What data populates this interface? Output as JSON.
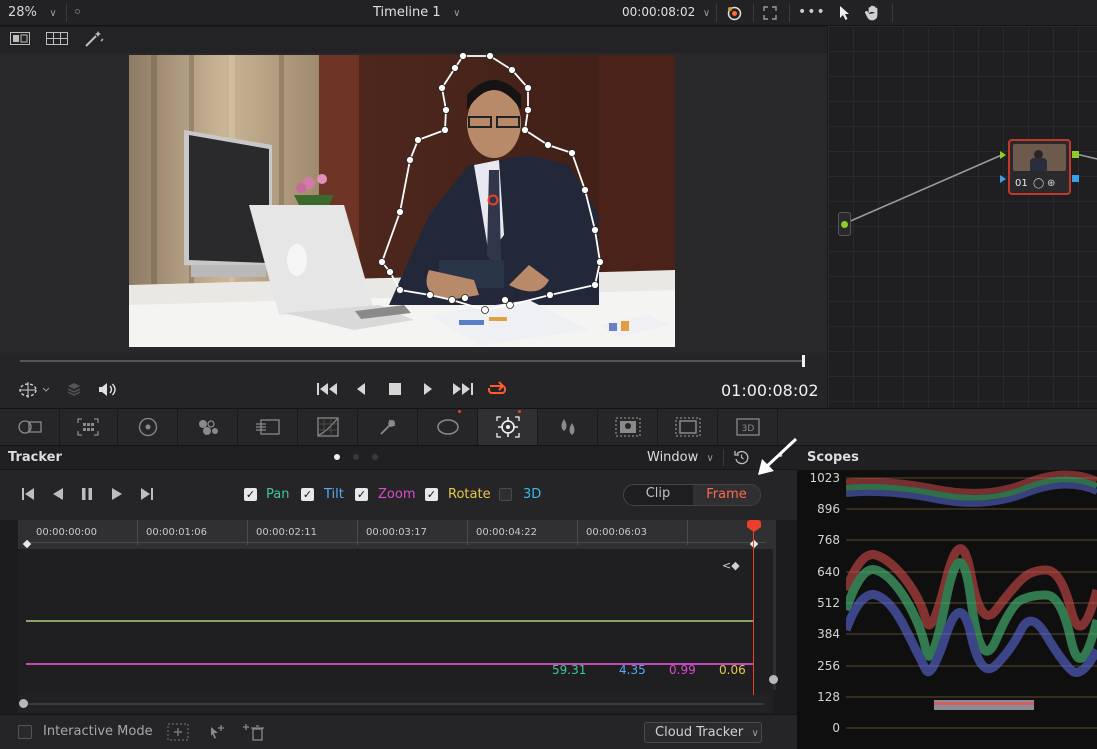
{
  "viewer": {
    "zoom": "28%",
    "timeline_title": "Timeline 1",
    "timecode_top": "00:00:08:02",
    "timecode_main": "01:00:08:02"
  },
  "node": {
    "label": "01"
  },
  "tracker": {
    "title": "Tracker",
    "window_label": "Window",
    "options": [
      {
        "label": "Pan",
        "checked": true,
        "color": "#3ec6a1"
      },
      {
        "label": "Tilt",
        "checked": true,
        "color": "#5aa9f2"
      },
      {
        "label": "Zoom",
        "checked": true,
        "color": "#d94bcb"
      },
      {
        "label": "Rotate",
        "checked": true,
        "color": "#e6c84a"
      },
      {
        "label": "3D",
        "checked": false,
        "color": "#39b8e6"
      }
    ],
    "mode_clip": "Clip",
    "mode_frame": "Frame",
    "ruler_ticks": [
      "00:00:00:00",
      "00:00:01:06",
      "00:00:02:11",
      "00:00:03:17",
      "00:00:04:22",
      "00:00:06:03"
    ],
    "values": [
      {
        "text": "59.31",
        "color": "#3ec6a1"
      },
      {
        "text": "4.35",
        "color": "#5aa9f2"
      },
      {
        "text": "0.99",
        "color": "#d94bcb"
      },
      {
        "text": "0.06",
        "color": "#e6c84a"
      }
    ],
    "interactive_mode": "Interactive Mode",
    "cloud_tracker": "Cloud Tracker"
  },
  "scopes": {
    "title": "Scopes",
    "scale": [
      "1023",
      "896",
      "768",
      "640",
      "512",
      "384",
      "256",
      "128",
      "0"
    ]
  },
  "colors": {
    "accent_red": "#e8402a",
    "frame_active": "#ff6a4a"
  }
}
